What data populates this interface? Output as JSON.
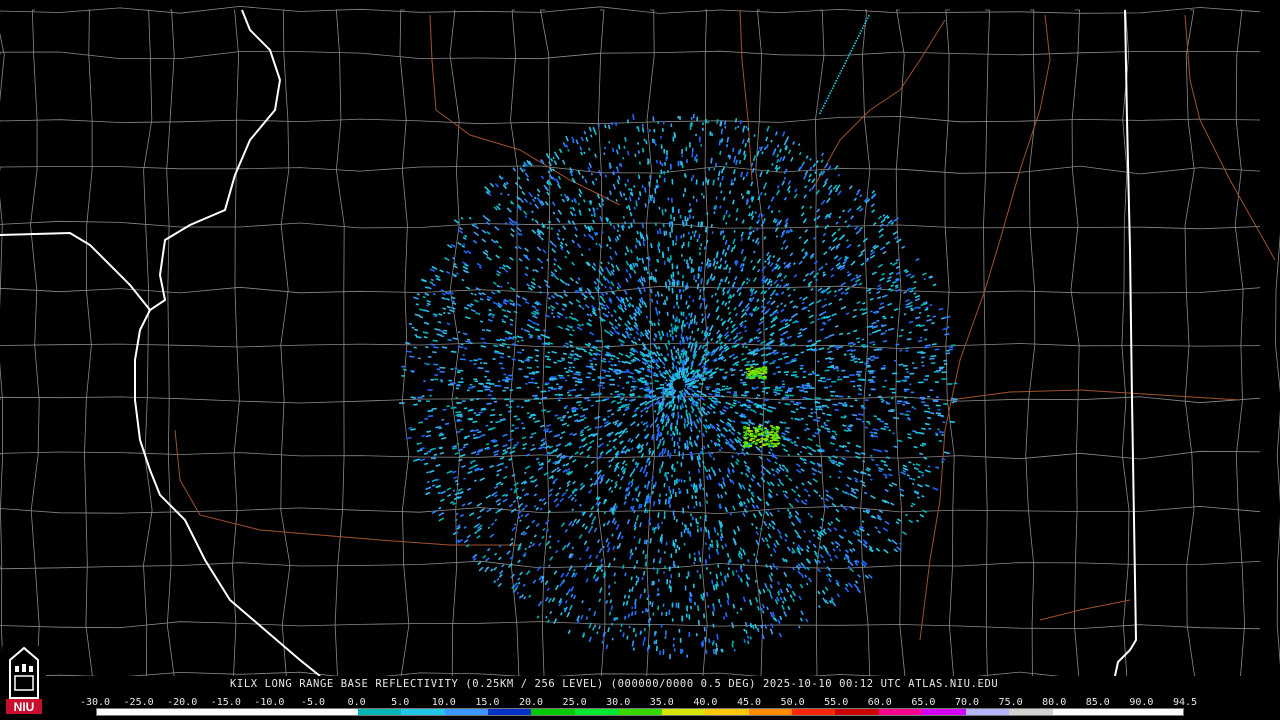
{
  "product": {
    "caption": "KILX LONG RANGE BASE REFLECTIVITY (0.25KM / 256 LEVEL) (000000/0000 0.5 DEG) 2025-10-10 00:12 UTC  ATLAS.NIU.EDU"
  },
  "logo": {
    "text": "NIU",
    "color": "#c8102e"
  },
  "radar_site": {
    "name": "KILX"
  },
  "color_scale": {
    "labels": [
      "-30.0",
      "-25.0",
      "-20.0",
      "-15.0",
      "-10.0",
      "-5.0",
      "0.0",
      "5.0",
      "10.0",
      "15.0",
      "20.0",
      "25.0",
      "30.0",
      "35.0",
      "40.0",
      "45.0",
      "50.0",
      "55.0",
      "60.0",
      "65.0",
      "70.0",
      "75.0",
      "80.0",
      "85.0",
      "90.0",
      "94.5"
    ],
    "colors": [
      "#ffffff",
      "#ffffff",
      "#ffffff",
      "#ffffff",
      "#ffffff",
      "#ffffff",
      "#00b4b4",
      "#1ec8e6",
      "#3c96ff",
      "#0032c8",
      "#00c800",
      "#00e632",
      "#38d800",
      "#d8e600",
      "#ffc800",
      "#ff8c00",
      "#ff2800",
      "#c80000",
      "#ff0090",
      "#d200ff",
      "#b4b4ff",
      "#d2d2d2",
      "#ffffff",
      "#ffffff",
      "#ffffff"
    ]
  },
  "colors": {
    "background": "#000000",
    "county_lines": "#8a8a8a",
    "state_lines": "#ffffff",
    "rivers": "#a0522d"
  }
}
